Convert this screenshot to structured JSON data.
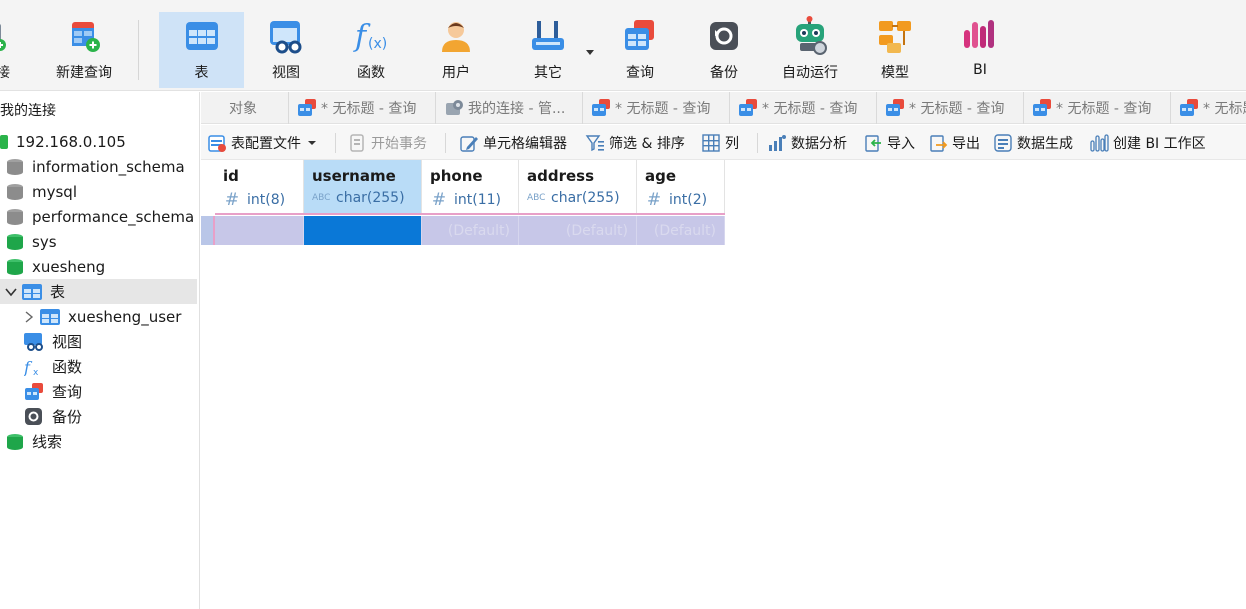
{
  "ribbon": {
    "partial_label": "接",
    "new_query": "新建查询",
    "buttons": [
      {
        "label": "表",
        "icon": "table-icon"
      },
      {
        "label": "视图",
        "icon": "view-icon"
      },
      {
        "label": "函数",
        "icon": "function-icon"
      },
      {
        "label": "用户",
        "icon": "user-icon"
      },
      {
        "label": "其它",
        "icon": "tools-icon"
      },
      {
        "label": "查询",
        "icon": "query-icon"
      },
      {
        "label": "备份",
        "icon": "backup-icon"
      },
      {
        "label": "自动运行",
        "icon": "robot-icon"
      },
      {
        "label": "模型",
        "icon": "model-icon"
      },
      {
        "label": "BI",
        "icon": "bi-icon"
      }
    ]
  },
  "sidebar": {
    "title": "我的连接",
    "connection": "192.168.0.105",
    "databases": [
      "information_schema",
      "mysql",
      "performance_schema",
      "sys",
      "xuesheng"
    ],
    "tables_node": "表",
    "table_name": "xuesheng_user",
    "children": [
      "视图",
      "函数",
      "查询",
      "备份"
    ],
    "last": "线索"
  },
  "tabs": {
    "objects": "对象",
    "items": [
      "* 无标题 - 查询",
      "我的连接 - 管...",
      "* 无标题 - 查询",
      "* 无标题 - 查询",
      "* 无标题 - 查询",
      "* 无标题 - 查询",
      "* 无标题"
    ]
  },
  "toolbar": {
    "profile": "表配置文件",
    "begin_tx": "开始事务",
    "cell_editor": "单元格编辑器",
    "filter_sort": "筛选 & 排序",
    "columns": "列",
    "analysis": "数据分析",
    "import": "导入",
    "export": "导出",
    "generate": "数据生成",
    "bi": "创建 BI 工作区"
  },
  "grid": {
    "columns": [
      {
        "name": "id",
        "type": "int(8)",
        "kind": "#"
      },
      {
        "name": "username",
        "type": "char(255)",
        "kind": "ABC"
      },
      {
        "name": "phone",
        "type": "int(11)",
        "kind": "#"
      },
      {
        "name": "address",
        "type": "char(255)",
        "kind": "ABC"
      },
      {
        "name": "age",
        "type": "int(2)",
        "kind": "#"
      }
    ],
    "row": [
      "",
      "",
      "(Default)",
      "(Default)",
      "(Default)"
    ]
  },
  "colors": {
    "accent": "#0a78d7",
    "selected_header": "#b9dcf7",
    "new_row": "#c7c7e8",
    "green_db": "#1fa64a",
    "gray_db": "#8c8c8c"
  }
}
